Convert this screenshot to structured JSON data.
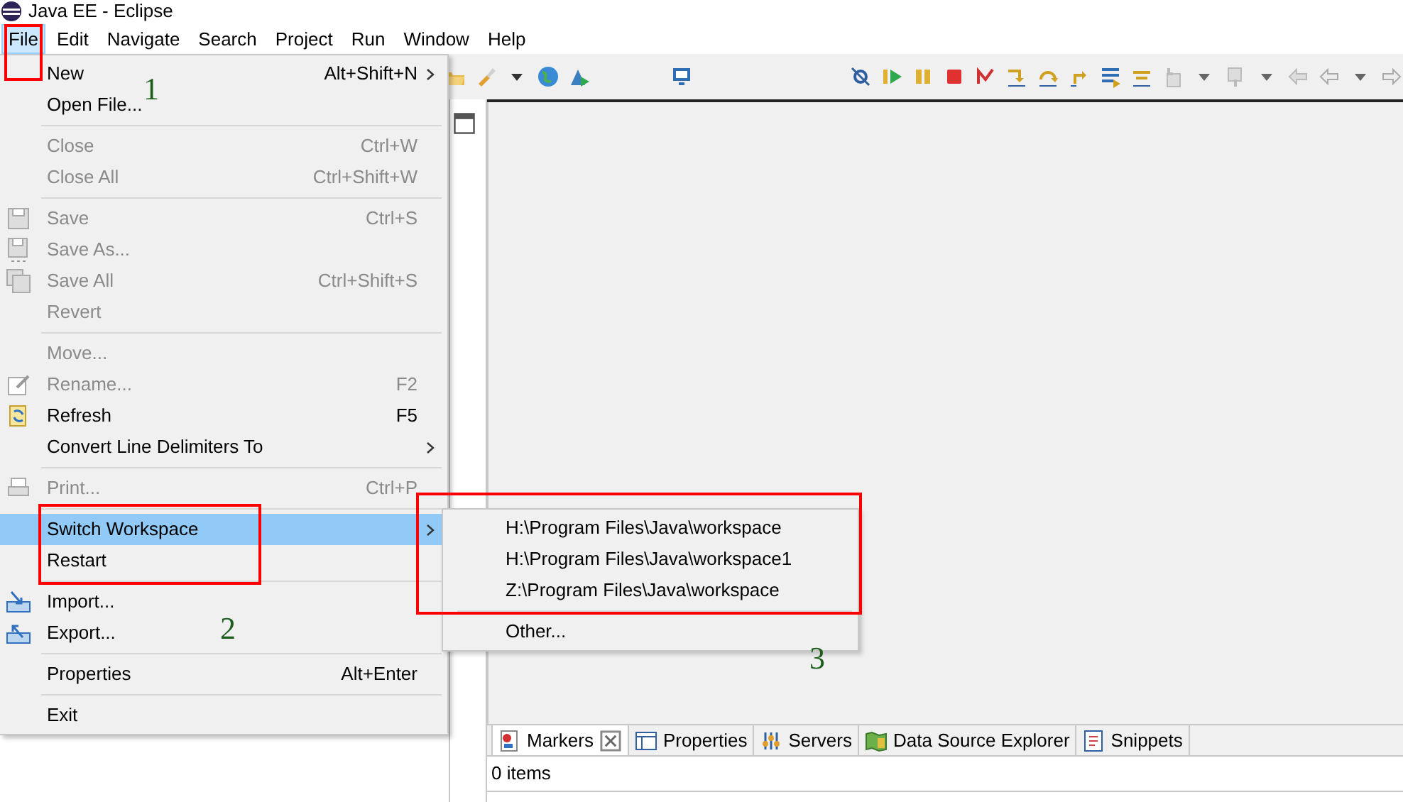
{
  "window": {
    "title": "Java EE - Eclipse"
  },
  "menubar": [
    {
      "label": "File",
      "selected": true
    },
    {
      "label": "Edit",
      "selected": false
    },
    {
      "label": "Navigate",
      "selected": false
    },
    {
      "label": "Search",
      "selected": false
    },
    {
      "label": "Project",
      "selected": false
    },
    {
      "label": "Run",
      "selected": false
    },
    {
      "label": "Window",
      "selected": false
    },
    {
      "label": "Help",
      "selected": false
    }
  ],
  "file_menu": [
    {
      "kind": "item",
      "label": "New",
      "shortcut": "Alt+Shift+N",
      "submenu": true,
      "disabled": false,
      "selected": false
    },
    {
      "kind": "item",
      "label": "Open File...",
      "disabled": false,
      "selected": false
    },
    {
      "kind": "separator"
    },
    {
      "kind": "item",
      "label": "Close",
      "shortcut": "Ctrl+W",
      "disabled": true,
      "selected": false
    },
    {
      "kind": "item",
      "label": "Close All",
      "shortcut": "Ctrl+Shift+W",
      "disabled": true,
      "selected": false
    },
    {
      "kind": "separator"
    },
    {
      "kind": "item",
      "label": "Save",
      "shortcut": "Ctrl+S",
      "disabled": true,
      "selected": false
    },
    {
      "kind": "item",
      "label": "Save As...",
      "disabled": true,
      "selected": false
    },
    {
      "kind": "item",
      "label": "Save All",
      "shortcut": "Ctrl+Shift+S",
      "disabled": true,
      "selected": false
    },
    {
      "kind": "item",
      "label": "Revert",
      "disabled": true,
      "selected": false
    },
    {
      "kind": "separator"
    },
    {
      "kind": "item",
      "label": "Move...",
      "disabled": true,
      "selected": false
    },
    {
      "kind": "item",
      "label": "Rename...",
      "shortcut": "F2",
      "disabled": true,
      "selected": false
    },
    {
      "kind": "item",
      "label": "Refresh",
      "shortcut": "F5",
      "disabled": false,
      "selected": false
    },
    {
      "kind": "item",
      "label": "Convert Line Delimiters To",
      "submenu": true,
      "disabled": false,
      "selected": false
    },
    {
      "kind": "separator"
    },
    {
      "kind": "item",
      "label": "Print...",
      "shortcut": "Ctrl+P",
      "disabled": true,
      "selected": false
    },
    {
      "kind": "separator"
    },
    {
      "kind": "item",
      "label": "Switch Workspace",
      "submenu": true,
      "disabled": false,
      "selected": true
    },
    {
      "kind": "item",
      "label": "Restart",
      "disabled": false,
      "selected": false
    },
    {
      "kind": "separator"
    },
    {
      "kind": "item",
      "label": "Import...",
      "disabled": false,
      "selected": false
    },
    {
      "kind": "item",
      "label": "Export...",
      "disabled": false,
      "selected": false
    },
    {
      "kind": "separator"
    },
    {
      "kind": "item",
      "label": "Properties",
      "shortcut": "Alt+Enter",
      "disabled": false,
      "selected": false
    },
    {
      "kind": "separator"
    },
    {
      "kind": "item",
      "label": "Exit",
      "disabled": false,
      "selected": false
    }
  ],
  "workspace_submenu": [
    {
      "kind": "item",
      "label": "H:\\Program Files\\Java\\workspace"
    },
    {
      "kind": "item",
      "label": "H:\\Program Files\\Java\\workspace1"
    },
    {
      "kind": "item",
      "label": "Z:\\Program Files\\Java\\workspace"
    },
    {
      "kind": "separator"
    },
    {
      "kind": "item",
      "label": "Other..."
    }
  ],
  "view_tabs": [
    {
      "label": "Markers",
      "selected": true
    },
    {
      "label": "Properties",
      "selected": false
    },
    {
      "label": "Servers",
      "selected": false
    },
    {
      "label": "Data Source Explorer",
      "selected": false
    },
    {
      "label": "Snippets",
      "selected": false
    }
  ],
  "markers_status": "0 items",
  "annotations": [
    "1",
    "2",
    "3"
  ]
}
